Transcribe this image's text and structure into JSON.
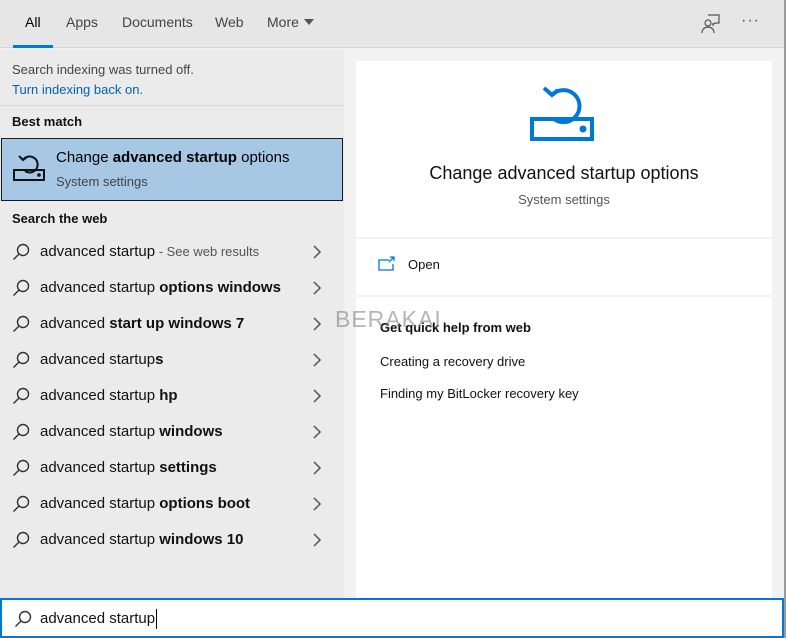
{
  "tabs": [
    {
      "label": "All",
      "active": true
    },
    {
      "label": "Apps",
      "active": false
    },
    {
      "label": "Documents",
      "active": false
    },
    {
      "label": "Web",
      "active": false
    },
    {
      "label": "More",
      "active": false
    }
  ],
  "top_icons": {
    "feedback": "feedback-person-icon",
    "more": "ellipsis-icon",
    "more_glyph": "···"
  },
  "notice": {
    "text": "Search indexing was turned off.",
    "link": "Turn indexing back on."
  },
  "best_match": {
    "section_label": "Best match",
    "title_prefix": "Change ",
    "title_bold": "advanced startup",
    "title_suffix": " options",
    "subtitle": "System settings"
  },
  "web": {
    "section_label": "Search the web",
    "items": [
      {
        "normal": "advanced startup",
        "bold": "",
        "hint": " - See web results"
      },
      {
        "normal": "advanced startup ",
        "bold": "options windows",
        "hint": ""
      },
      {
        "normal": "advanced ",
        "bold": "start up windows 7",
        "hint": ""
      },
      {
        "normal": "advanced startup",
        "bold": "s",
        "hint": ""
      },
      {
        "normal": "advanced startup ",
        "bold": "hp",
        "hint": ""
      },
      {
        "normal": "advanced startup ",
        "bold": "windows",
        "hint": ""
      },
      {
        "normal": "advanced startup ",
        "bold": "settings",
        "hint": ""
      },
      {
        "normal": "advanced startup ",
        "bold": "options boot",
        "hint": ""
      },
      {
        "normal": "advanced startup ",
        "bold": "windows 10",
        "hint": ""
      }
    ]
  },
  "preview": {
    "title": "Change advanced startup options",
    "subtitle": "System settings",
    "open_label": "Open",
    "help_title": "Get quick help from web",
    "help_links": [
      "Creating a recovery drive",
      "Finding my BitLocker recovery key"
    ]
  },
  "watermark": "BERAKAI",
  "search": {
    "value": "advanced startup"
  },
  "colors": {
    "accent": "#0078d7",
    "selection": "#a6c8e4",
    "link": "#0063b1"
  }
}
